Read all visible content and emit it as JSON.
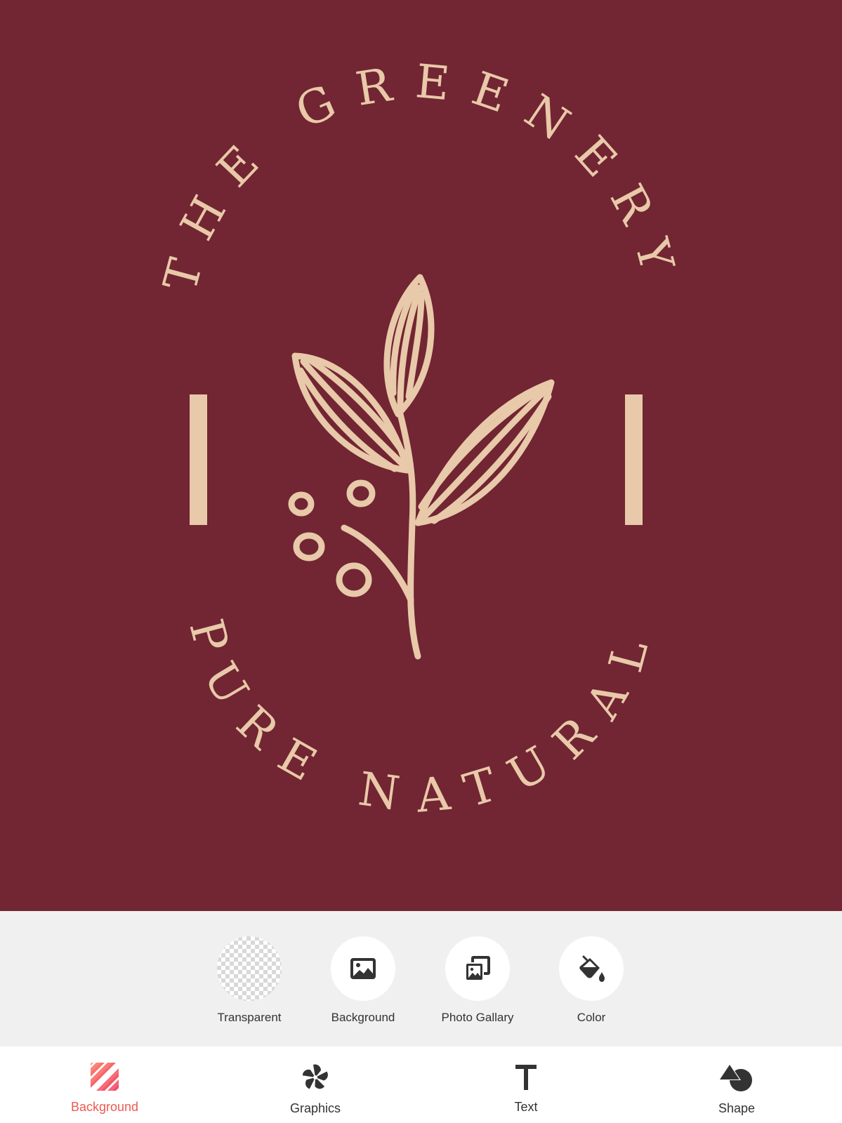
{
  "logo": {
    "top_text": "THE GREENERY",
    "bottom_text": "PURE NATURAL"
  },
  "colors": {
    "canvas_background": "#722533",
    "logo": "#e8c9a9",
    "panel_background": "#f0f0f0",
    "active_tab": "#ee5a52",
    "icon": "#333333"
  },
  "background_options": [
    {
      "label": "Transparent",
      "icon": "checkerboard-icon"
    },
    {
      "label": "Background",
      "icon": "image-icon"
    },
    {
      "label": "Photo Gallary",
      "icon": "photo-gallery-icon"
    },
    {
      "label": "Color",
      "icon": "paint-bucket-icon"
    }
  ],
  "tabs": [
    {
      "label": "Background",
      "icon": "background-stripes-icon",
      "active": true
    },
    {
      "label": "Graphics",
      "icon": "pinwheel-icon",
      "active": false
    },
    {
      "label": "Text",
      "icon": "text-icon",
      "active": false
    },
    {
      "label": "Shape",
      "icon": "shapes-icon",
      "active": false
    }
  ]
}
